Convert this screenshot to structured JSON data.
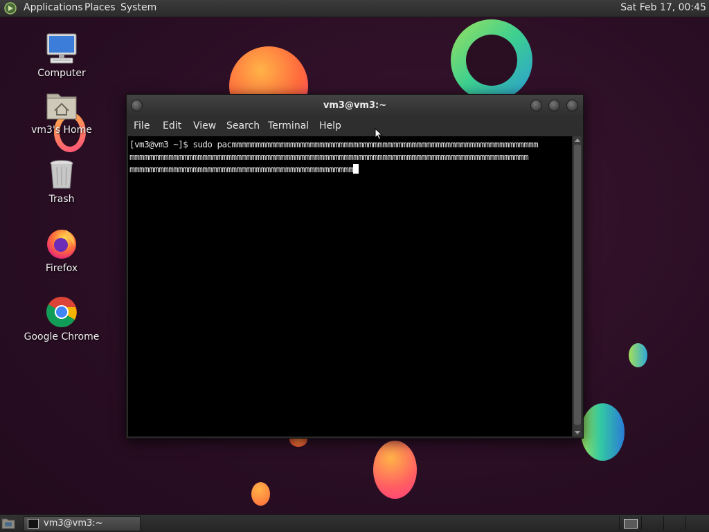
{
  "top_panel": {
    "menus": [
      "Applications",
      "Places",
      "System"
    ],
    "clock": "Sat Feb 17, 00:45"
  },
  "desktop": {
    "icons": [
      {
        "label": "Computer",
        "icon": "computer-icon"
      },
      {
        "label": "vm3's Home",
        "icon": "home-folder-icon"
      },
      {
        "label": "Trash",
        "icon": "trash-icon"
      },
      {
        "label": "Firefox",
        "icon": "firefox-icon"
      },
      {
        "label": "Google Chrome",
        "icon": "chrome-icon"
      }
    ]
  },
  "terminal": {
    "title": "vm3@vm3:~",
    "menu": [
      "File",
      "Edit",
      "View",
      "Search",
      "Terminal",
      "Help"
    ],
    "lines": [
      "[vm3@vm3 ~]$ sudo pacmmmmmmmmmmmmmmmmmmmmmmmmmmmmmmmmmmmmmmmmmmmmmmmmmmmmmmmmmmmmmmm",
      "mmmmmmmmmmmmmmmmmmmmmmmmmmmmmmmmmmmmmmmmmmmmmmmmmmmmmmmmmmmmmmmmmmmmmmmmmmmmmmmmmm",
      "mmmmmmmmmmmmmmmmmmmmmmmmmmmmmmmmmmmmmmmmmmmmmm"
    ]
  },
  "taskbar": {
    "tasks": [
      {
        "label": "vm3@vm3:~",
        "icon": "terminal-icon"
      }
    ]
  },
  "colors": {
    "background": "#2a0e22",
    "panel": "#2b2b2b",
    "terminal_bg": "#000000",
    "terminal_fg": "#e6e6e6"
  }
}
